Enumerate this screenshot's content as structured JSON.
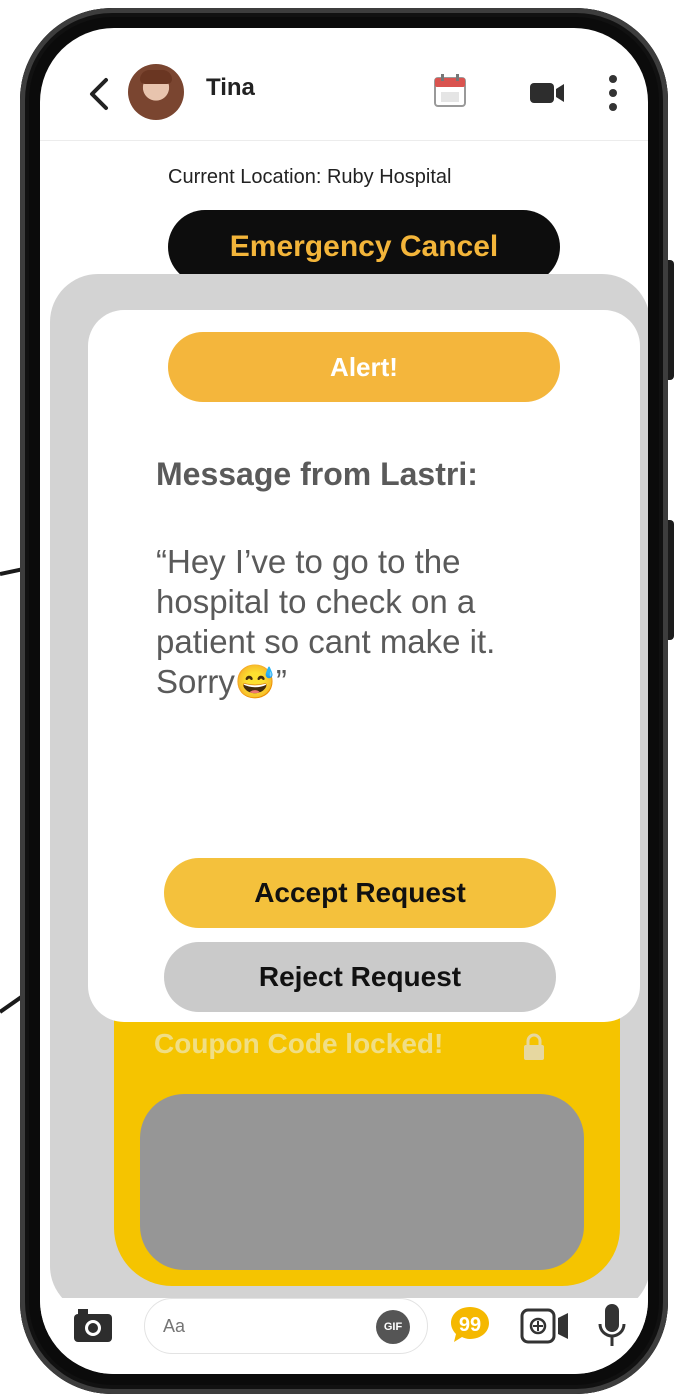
{
  "header": {
    "contact_name": "Tina"
  },
  "location_text": "Current Location: Ruby Hospital",
  "emergency_button": "Emergency Cancel",
  "alert": {
    "title": "Alert!",
    "message_title": "Message from Lastri:",
    "message_body": "“Hey I’ve to go to the hospital to check on a patient so cant make it. Sorry😅”",
    "accept_label": "Accept Request",
    "reject_label": "Reject Request"
  },
  "coupon": {
    "label": "Coupon Code locked!"
  },
  "composer": {
    "placeholder": "Aa",
    "gif_label": "GIF"
  },
  "icons": [
    "back-icon",
    "calendar-icon",
    "video-call-icon",
    "more-icon",
    "camera-icon",
    "gif-icon",
    "quote-bubble-icon",
    "live-camera-icon",
    "microphone-icon",
    "lock-icon"
  ],
  "colors": {
    "accent_yellow": "#f4b63c",
    "coupon_yellow": "#f5c400",
    "emergency_text": "#f3b53a",
    "dark": "#0d0d0d",
    "grey": "#cacaca"
  }
}
